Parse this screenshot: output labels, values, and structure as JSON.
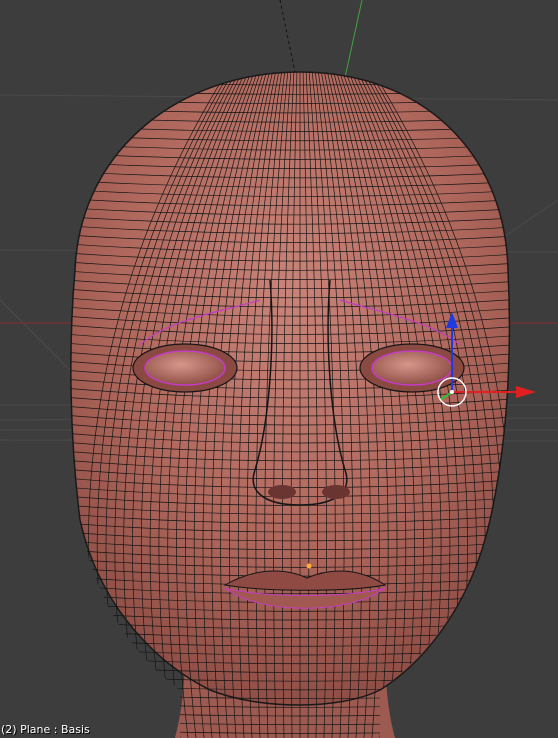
{
  "viewport": {
    "object_info": "(2) Plane : Basis",
    "background_color": "#3d3d3d",
    "grid_color": "#4a4a4a",
    "x_axis_color": "#8a2a2a",
    "y_axis_color": "#3fa33f",
    "mesh_color": "#b56a60",
    "wire_color": "#151515",
    "seam_color": "#c43cc4"
  },
  "gizmo": {
    "x_arrow_color": "#e02020",
    "z_arrow_color": "#1f3ae0",
    "y_axis_color": "#30c030",
    "cursor_ring_color": "#ffffff"
  }
}
